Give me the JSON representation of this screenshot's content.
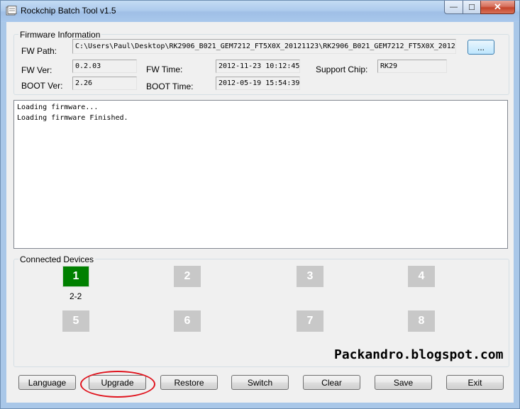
{
  "window": {
    "title": "Rockchip Batch Tool v1.5"
  },
  "caption_buttons": {
    "minimize": "—",
    "maximize": "☐",
    "close": "✕"
  },
  "firmware": {
    "group_title": "Firmware Information",
    "fw_path_label": "FW Path:",
    "fw_path_value": "C:\\Users\\Paul\\Desktop\\RK2906_B021_GEM7212_FT5X0X_20121123\\RK2906_B021_GEM7212_FT5X0X_2012",
    "browse_label": "...",
    "fw_ver_label": "FW Ver:",
    "fw_ver_value": "0.2.03",
    "fw_time_label": "FW Time:",
    "fw_time_value": "2012-11-23 10:12:45",
    "support_chip_label": "Support Chip:",
    "support_chip_value": "RK29",
    "boot_ver_label": "BOOT Ver:",
    "boot_ver_value": "2.26",
    "boot_time_label": "BOOT Time:",
    "boot_time_value": "2012-05-19 15:54:39"
  },
  "log": {
    "lines": [
      "Loading firmware...",
      "Loading firmware Finished."
    ]
  },
  "devices": {
    "group_title": "Connected Devices",
    "slots": [
      {
        "label": "1",
        "sub": "2-2",
        "active": true
      },
      {
        "label": "2"
      },
      {
        "label": "3"
      },
      {
        "label": "4"
      },
      {
        "label": "5"
      },
      {
        "label": "6"
      },
      {
        "label": "7"
      },
      {
        "label": "8"
      }
    ]
  },
  "watermark": "Packandro.blogspot.com",
  "buttons": {
    "language": "Language",
    "upgrade": "Upgrade",
    "restore": "Restore",
    "switch": "Switch",
    "clear": "Clear",
    "save": "Save",
    "exit": "Exit"
  },
  "colors": {
    "active_device": "#008000",
    "inactive_device": "#c8c8c8",
    "annotation_circle": "#e0141e"
  }
}
